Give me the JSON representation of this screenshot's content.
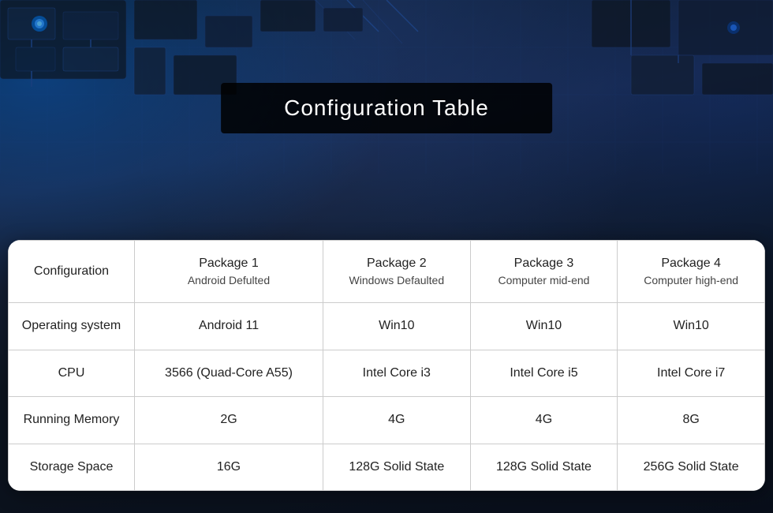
{
  "hero": {
    "title": "Configuration Table"
  },
  "table": {
    "headers": {
      "config_label": "Configuration",
      "packages": [
        {
          "name": "Package 1",
          "sub": "Android Defulted"
        },
        {
          "name": "Package 2",
          "sub": "Windows Defaulted"
        },
        {
          "name": "Package 3",
          "sub": "Computer mid-end"
        },
        {
          "name": "Package 4",
          "sub": "Computer high-end"
        }
      ]
    },
    "rows": [
      {
        "label": "Operating system",
        "values": [
          "Android 11",
          "Win10",
          "Win10",
          "Win10"
        ]
      },
      {
        "label": "CPU",
        "values": [
          "3566 (Quad-Core A55)",
          "Intel Core i3",
          "Intel Core i5",
          "Intel Core i7"
        ]
      },
      {
        "label": "Running Memory",
        "values": [
          "2G",
          "4G",
          "4G",
          "8G"
        ]
      },
      {
        "label": "Storage Space",
        "values": [
          "16G",
          "128G Solid State",
          "128G Solid State",
          "256G Solid State"
        ]
      }
    ]
  }
}
